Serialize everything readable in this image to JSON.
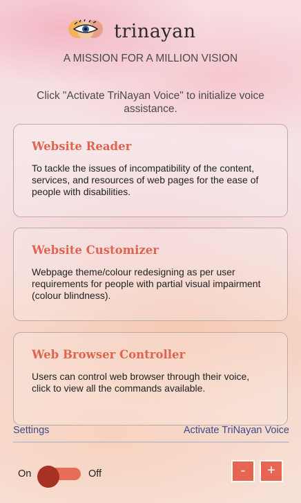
{
  "header": {
    "brand": "trinayan",
    "logo_icon": "eye-logo-icon",
    "tagline": "A MISSION FOR A MILLION VISION"
  },
  "instruction": "Click \"Activate TriNayan Voice\" to initialize voice assistance.",
  "cards": [
    {
      "title": "Website Reader",
      "description": "To tackle the issues of incompatibility of the content, services, and resources of web pages for the ease of people with disabilities."
    },
    {
      "title": "Website Customizer",
      "description": "Webpage theme/colour redesigning as per user requirements for people with partial visual impairment (colour blindness)."
    },
    {
      "title": "Web Browser Controller",
      "description": "Users can control web browser through their voice, click to view all the commands available."
    }
  ],
  "footer": {
    "settings_label": "Settings",
    "activate_label": "Activate TriNayan Voice"
  },
  "toggle": {
    "on_label": "On",
    "off_label": "Off",
    "state": "On"
  },
  "zoom": {
    "minus_label": "-",
    "plus_label": "+"
  },
  "colors": {
    "accent": "#df6450",
    "link": "#3b4a8a",
    "knob": "#a73224"
  }
}
